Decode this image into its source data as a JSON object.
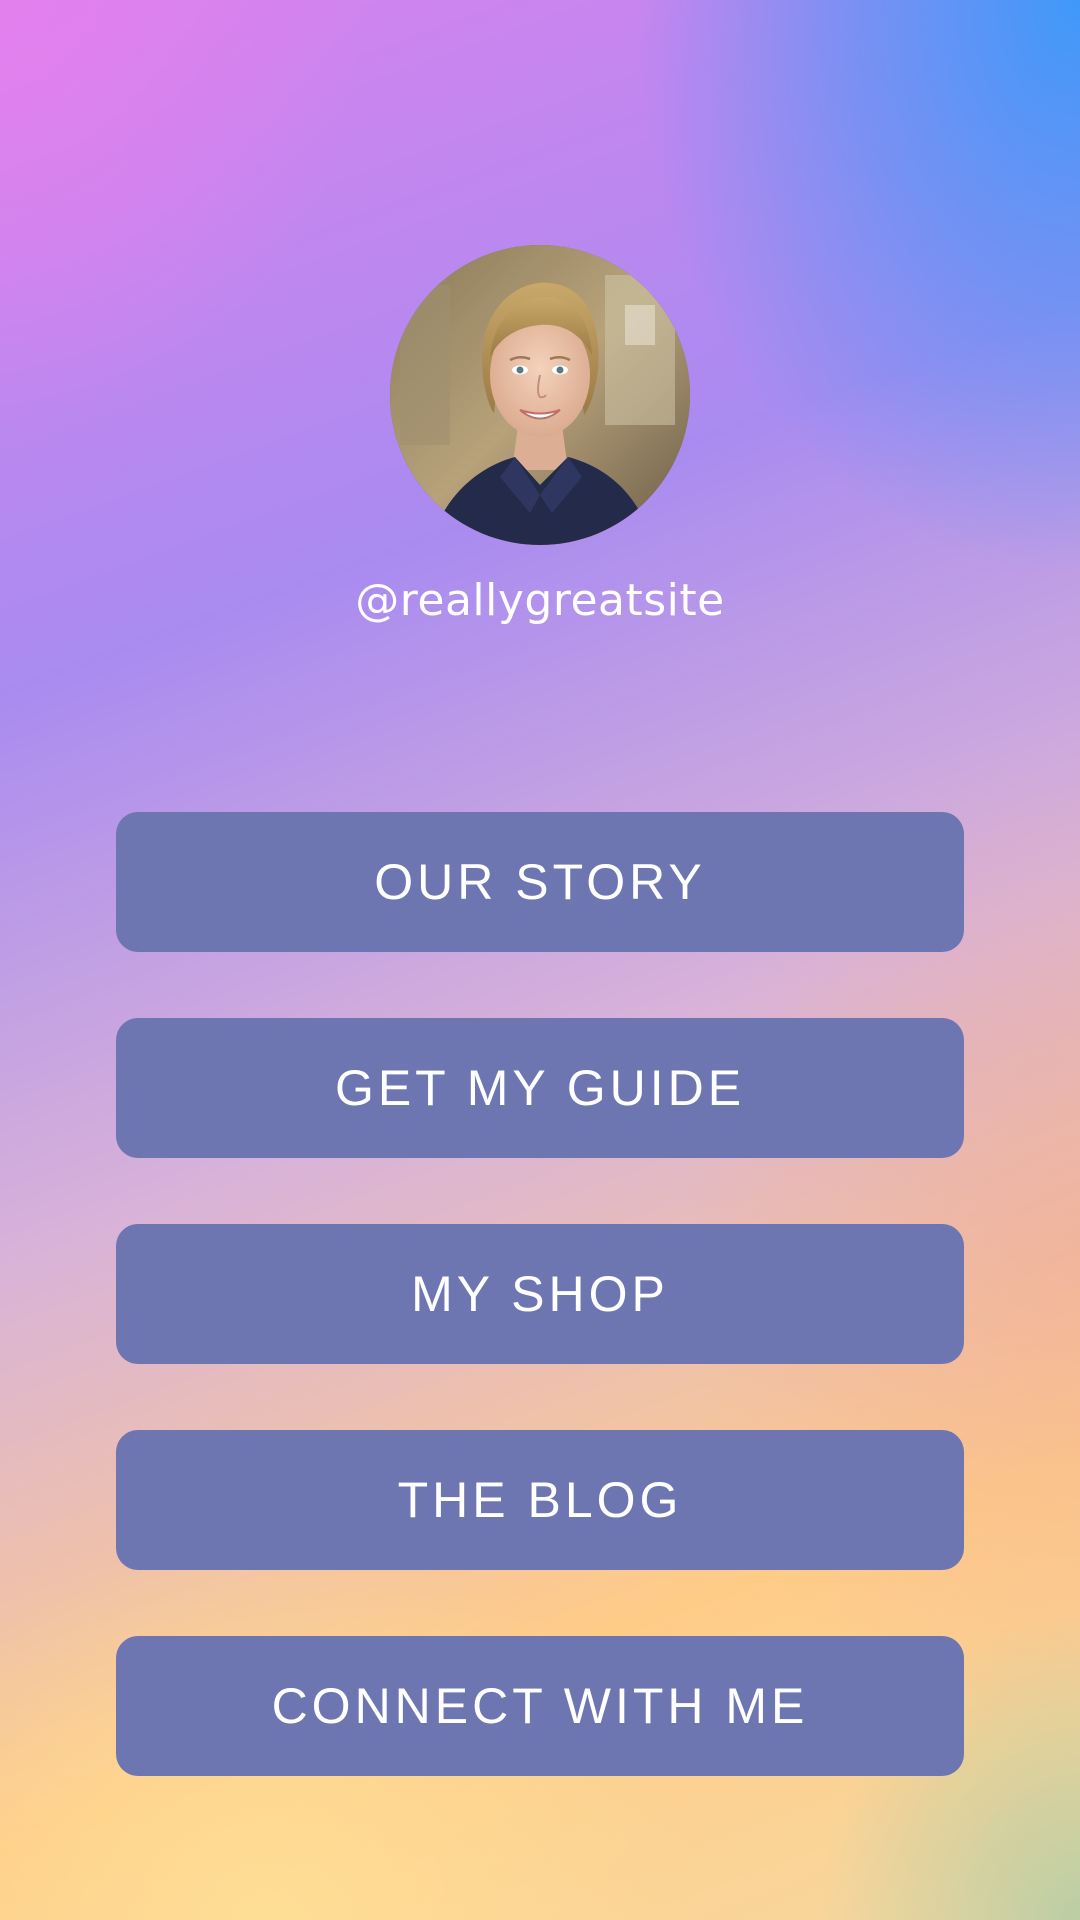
{
  "profile": {
    "handle": "@reallygreatsite",
    "avatar_description": "profile-photo"
  },
  "links": [
    {
      "label": "OUR STORY",
      "name": "our-story-button"
    },
    {
      "label": "GET MY GUIDE",
      "name": "get-my-guide-button"
    },
    {
      "label": "MY SHOP",
      "name": "my-shop-button"
    },
    {
      "label": "THE BLOG",
      "name": "the-blog-button"
    },
    {
      "label": "CONNECT WITH ME",
      "name": "connect-with-me-button"
    }
  ],
  "colors": {
    "button_bg": "#6e76b2",
    "button_text": "#ffffff",
    "handle_text": "#ffffff",
    "gradient_top_left": "#d882ee",
    "gradient_top_right": "#389afa",
    "gradient_bottom": "#ffcc88"
  }
}
